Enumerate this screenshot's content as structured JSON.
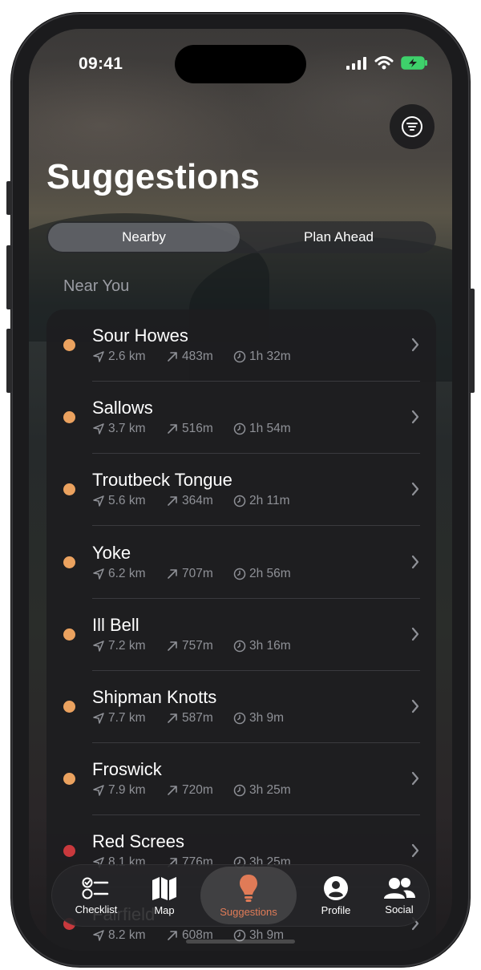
{
  "status_bar": {
    "time": "09:41"
  },
  "header": {
    "title": "Suggestions",
    "filter_icon": "filter-lines-icon"
  },
  "segments": [
    {
      "label": "Nearby",
      "active": true
    },
    {
      "label": "Plan Ahead",
      "active": false
    }
  ],
  "section": {
    "label": "Near You"
  },
  "colors": {
    "orange_dot": "#eba25f",
    "red_dot": "#c9393d",
    "accent": "#e07b57"
  },
  "items": [
    {
      "name": "Sour Howes",
      "distance": "2.6 km",
      "ascent": "483m",
      "time": "1h 32m",
      "dot": "orange"
    },
    {
      "name": "Sallows",
      "distance": "3.7 km",
      "ascent": "516m",
      "time": "1h 54m",
      "dot": "orange"
    },
    {
      "name": "Troutbeck Tongue",
      "distance": "5.6 km",
      "ascent": "364m",
      "time": "2h 11m",
      "dot": "orange"
    },
    {
      "name": "Yoke",
      "distance": "6.2 km",
      "ascent": "707m",
      "time": "2h 56m",
      "dot": "orange"
    },
    {
      "name": "Ill Bell",
      "distance": "7.2 km",
      "ascent": "757m",
      "time": "3h 16m",
      "dot": "orange"
    },
    {
      "name": "Shipman Knotts",
      "distance": "7.7 km",
      "ascent": "587m",
      "time": "3h 9m",
      "dot": "orange"
    },
    {
      "name": "Froswick",
      "distance": "7.9 km",
      "ascent": "720m",
      "time": "3h 25m",
      "dot": "orange"
    },
    {
      "name": "Red Screes",
      "distance": "8.1 km",
      "ascent": "776m",
      "time": "3h 25m",
      "dot": "red"
    },
    {
      "name": "Fairfield",
      "distance": "8.2 km",
      "ascent": "608m",
      "time": "3h 9m",
      "dot": "red"
    }
  ],
  "tabbar": [
    {
      "label": "Checklist",
      "icon": "checklist-icon",
      "active": false
    },
    {
      "label": "Map",
      "icon": "map-icon",
      "active": false
    },
    {
      "label": "Suggestions",
      "icon": "lightbulb-icon",
      "active": true
    },
    {
      "label": "Profile",
      "icon": "person-circle-icon",
      "active": false
    },
    {
      "label": "Social",
      "icon": "people-icon",
      "active": false
    }
  ]
}
